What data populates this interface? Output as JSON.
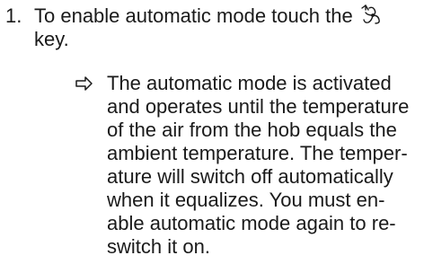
{
  "step": {
    "number": "1.",
    "line_1": "To enable automatic mode touch the",
    "line_2": "key.",
    "key_icon": "automatic-mode-fan-icon"
  },
  "result": {
    "arrow_icon": "result-arrow-icon",
    "lines": [
      "The automatic mode is activated",
      "and operates until the temperature",
      "of the air from the hob equals the",
      "ambient temperature. The temper-",
      "ature will switch off automatically",
      "when it equalizes. You must en-",
      "able automatic mode again to re-",
      "switch it on."
    ]
  }
}
